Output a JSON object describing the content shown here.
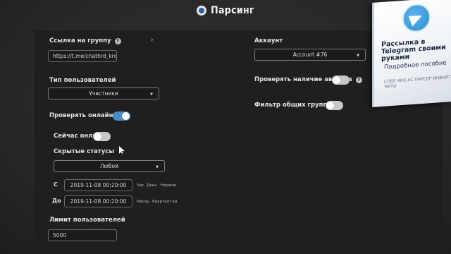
{
  "header": {
    "title": "Парсинг",
    "logo_icon": "app-logo-icon"
  },
  "form": {
    "group_link": {
      "label": "Ссылка на группу",
      "value": "https://t.me/chathrd_krdchat"
    },
    "user_type": {
      "label": "Тип пользователей",
      "selected": "Участники"
    },
    "check_online": {
      "label": "Проверять онлайн",
      "on": true
    },
    "now_online": {
      "label": "Сейчас онлайн",
      "on": false
    },
    "hidden_statuses": {
      "label": "Скрытые статусы",
      "selected": "Любой"
    },
    "date_from": {
      "prefix": "С",
      "value": "2019-11-08 00:20:00",
      "quick": [
        "Час",
        "День",
        "Неделя"
      ]
    },
    "date_to": {
      "prefix": "До",
      "value": "2019-11-08 00:20:00",
      "quick": [
        "Месяц",
        "Квартал",
        "Год"
      ]
    },
    "user_limit": {
      "label": "Лимит пользователей",
      "value": "5000"
    },
    "account": {
      "label": "Аккаунт",
      "selected": "Account #76"
    },
    "check_avatar": {
      "label": "Проверять наличие аватара",
      "on": false
    },
    "common_groups": {
      "label": "Фильтр общих групп",
      "on": false
    }
  },
  "overlay_book": {
    "title": "Рассылка в Telegram своими руками",
    "subtitle": "Подробное пособие",
    "tagline": "СОБЕ АКК АС ПАРСЕР ИНВАЙТ ЧАТЫ"
  },
  "colors": {
    "accent": "#4c8ac4",
    "panel": "#1f1f1f",
    "background": "#2c2c2c"
  }
}
